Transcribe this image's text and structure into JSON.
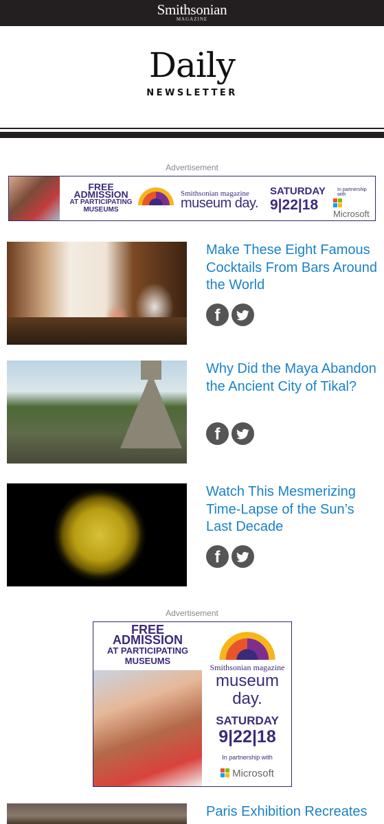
{
  "header": {
    "brand": "Smithsonian",
    "brand_sub": "MAGAZINE",
    "title": "Daily",
    "subtitle": "NEWSLETTER"
  },
  "ads": {
    "label": "Advertisement",
    "banner": {
      "free_line1": "FREE",
      "free_line2": "ADMISSION",
      "free_line3": "AT PARTICIPATING",
      "free_line4": "MUSEUMS",
      "brand_small": "Smithsonian magazine",
      "brand_big": "museum day.",
      "day": "SATURDAY",
      "date": "9|22|18",
      "partner_text": "In partnership with",
      "partner": "Microsoft"
    },
    "square": {
      "free_line1": "FREE",
      "free_line2": "ADMISSION",
      "free_line3": "AT PARTICIPATING",
      "free_line4": "MUSEUMS",
      "brand_small": "Smithsonian magazine",
      "brand_big1": "museum",
      "brand_big2": "day.",
      "day": "SATURDAY",
      "date": "9|22|18",
      "partner_text": "In partnership with",
      "partner": "Microsoft"
    }
  },
  "articles": [
    {
      "title": "Make These Eight Famous Cocktails From Bars Around the World"
    },
    {
      "title": "Why Did the Maya Abandon the Ancient City of Tikal?"
    },
    {
      "title": "Watch This Mesmerizing Time-Lapse of the Sun’s Last Decade"
    },
    {
      "title": "Paris Exhibition Recreates"
    }
  ],
  "social": {
    "facebook_glyph": "f"
  },
  "colors": {
    "header_bar": "#231f20",
    "link": "#1a82c8",
    "ad_purple": "#3b2a7a",
    "social_bg": "#555555"
  },
  "icons": [
    "facebook-icon",
    "twitter-icon",
    "museum-day-logo-icon",
    "microsoft-logo-icon"
  ]
}
